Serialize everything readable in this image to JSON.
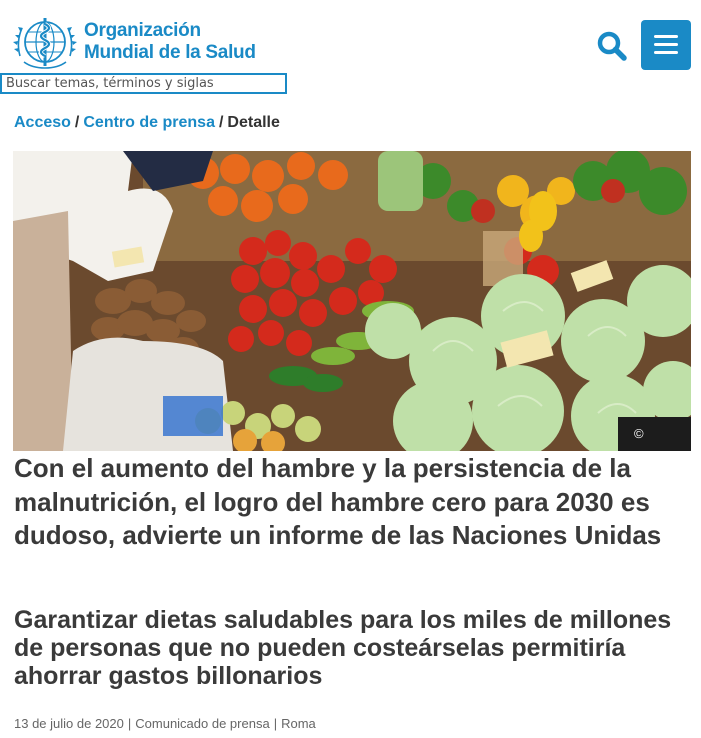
{
  "brand": {
    "line1": "Organización",
    "line2": "Mundial de la Salud",
    "color": "#1a8ac6"
  },
  "header": {
    "search_icon": "search-icon",
    "menu_icon": "hamburger-menu-icon"
  },
  "search": {
    "placeholder": "Buscar temas, términos y siglas"
  },
  "breadcrumb": {
    "items": [
      "Acceso",
      "Centro de prensa"
    ],
    "separator": "/",
    "current": "Detalle"
  },
  "hero": {
    "credit": "©"
  },
  "article": {
    "title": "Con el aumento del hambre y la persistencia de la malnutrición, el logro del hambre cero para 2030 es dudoso, advierte un informe de las Naciones Unidas",
    "subtitle": "Garantizar dietas saludables para los miles de millones de personas que no pueden costeárselas permitiría ahorrar gastos billonarios",
    "date": "13 de julio de 2020",
    "type": "Comunicado de prensa",
    "location": "Roma",
    "meta_separator": "|"
  }
}
